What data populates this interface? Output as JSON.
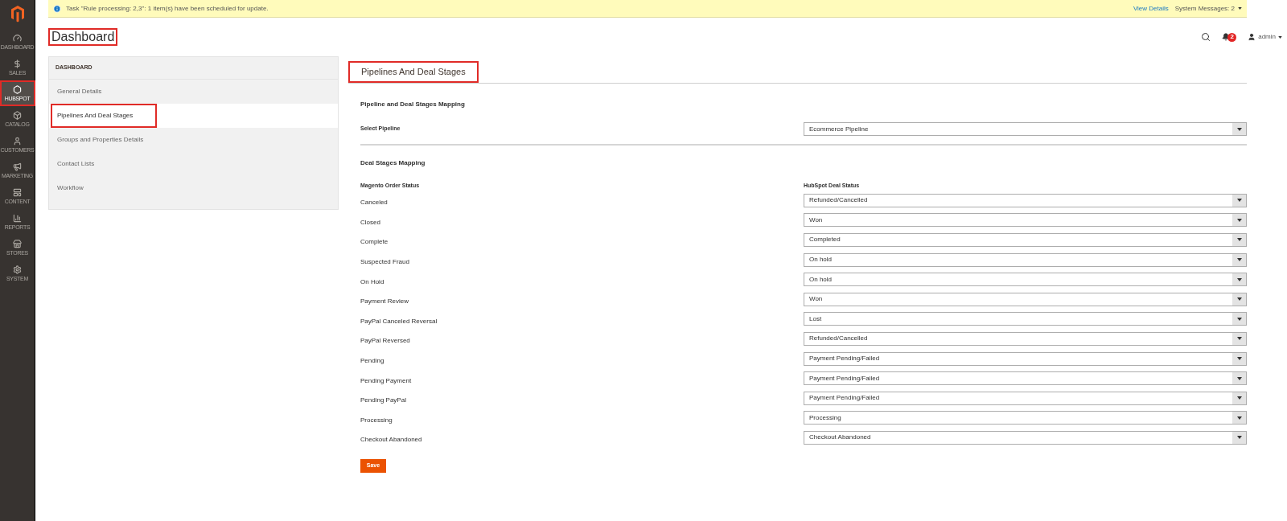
{
  "sidebar": {
    "items": [
      {
        "label": "DASHBOARD",
        "selected": false
      },
      {
        "label": "SALES",
        "selected": false
      },
      {
        "label": "HUBSPOT",
        "selected": true
      },
      {
        "label": "CATALOG",
        "selected": false
      },
      {
        "label": "CUSTOMERS",
        "selected": false
      },
      {
        "label": "MARKETING",
        "selected": false
      },
      {
        "label": "CONTENT",
        "selected": false
      },
      {
        "label": "REPORTS",
        "selected": false
      },
      {
        "label": "STORES",
        "selected": false
      },
      {
        "label": "SYSTEM",
        "selected": false
      }
    ]
  },
  "notice": {
    "message": "Task \"Rule processing: 2,3\": 1 item(s) have been scheduled for update.",
    "link": "View Details",
    "messages": "System Messages: 2"
  },
  "header": {
    "title": "Dashboard",
    "notifications": "2",
    "user": "admin"
  },
  "tabs_panel": {
    "heading": "DASHBOARD",
    "items": [
      {
        "label": "General Details",
        "selected": false
      },
      {
        "label": "Pipelines And Deal Stages",
        "selected": true
      },
      {
        "label": "Groups and Properties Details",
        "selected": false
      },
      {
        "label": "Contact Lists",
        "selected": false
      },
      {
        "label": "Workflow",
        "selected": false
      }
    ]
  },
  "content": {
    "title": "Pipelines And Deal Stages",
    "pipeline_section": "Pipeline and Deal Stages Mapping",
    "pipeline_label": "Select Pipeline",
    "pipeline_value": "Ecommerce Pipeline",
    "stages_section": "Deal Stages Mapping",
    "col_left": "Magento Order Status",
    "col_right": "HubSpot Deal Status",
    "rows": [
      {
        "status": "Canceled",
        "deal": "Refunded/Cancelled"
      },
      {
        "status": "Closed",
        "deal": "Won"
      },
      {
        "status": "Complete",
        "deal": "Completed"
      },
      {
        "status": "Suspected Fraud",
        "deal": "On hold"
      },
      {
        "status": "On Hold",
        "deal": "On hold"
      },
      {
        "status": "Payment Review",
        "deal": "Won"
      },
      {
        "status": "PayPal Canceled Reversal",
        "deal": "Lost"
      },
      {
        "status": "PayPal Reversed",
        "deal": "Refunded/Cancelled"
      },
      {
        "status": "Pending",
        "deal": "Payment Pending/Failed"
      },
      {
        "status": "Pending Payment",
        "deal": "Payment Pending/Failed"
      },
      {
        "status": "Pending PayPal",
        "deal": "Payment Pending/Failed"
      },
      {
        "status": "Processing",
        "deal": "Processing"
      },
      {
        "status": "Checkout Abandoned",
        "deal": "Checkout Abandoned"
      }
    ],
    "save": "Save"
  }
}
